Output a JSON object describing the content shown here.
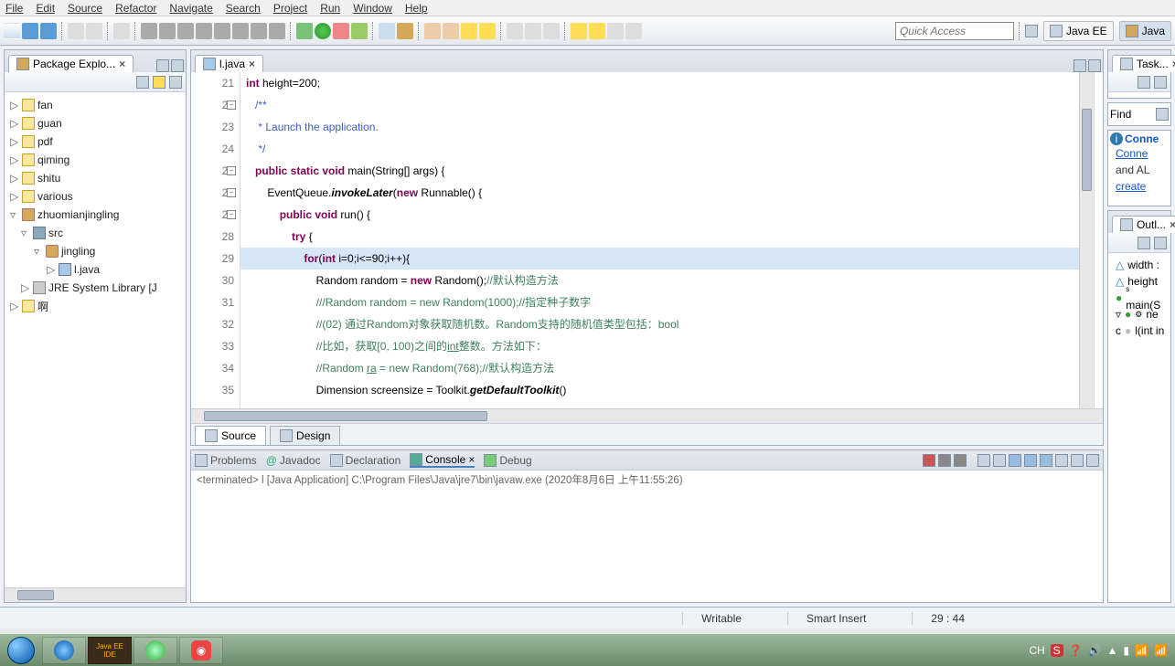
{
  "menu": [
    "File",
    "Edit",
    "Source",
    "Refactor",
    "Navigate",
    "Search",
    "Project",
    "Run",
    "Window",
    "Help"
  ],
  "quick_access_placeholder": "Quick Access",
  "perspectives": [
    {
      "label": "Java EE"
    },
    {
      "label": "Java"
    }
  ],
  "package_explorer": {
    "title": "Package Explo...",
    "items": [
      {
        "label": "fan",
        "depth": 0,
        "ico": "fold",
        "arrow": "▷"
      },
      {
        "label": "guan",
        "depth": 0,
        "ico": "fold",
        "arrow": "▷"
      },
      {
        "label": "pdf",
        "depth": 0,
        "ico": "fold",
        "arrow": "▷"
      },
      {
        "label": "qiming",
        "depth": 0,
        "ico": "fold",
        "arrow": "▷"
      },
      {
        "label": "shitu",
        "depth": 0,
        "ico": "fold",
        "arrow": "▷"
      },
      {
        "label": "various",
        "depth": 0,
        "ico": "fold",
        "arrow": "▷"
      },
      {
        "label": "zhuomianjingling",
        "depth": 0,
        "ico": "prj",
        "arrow": "▿"
      },
      {
        "label": "src",
        "depth": 1,
        "ico": "src",
        "arrow": "▿"
      },
      {
        "label": "jingling",
        "depth": 2,
        "ico": "pkg",
        "arrow": "▿"
      },
      {
        "label": "l.java",
        "depth": 3,
        "ico": "java",
        "arrow": "▷"
      },
      {
        "label": "JRE System Library [J",
        "depth": 1,
        "ico": "lib",
        "arrow": "▷"
      },
      {
        "label": "啊",
        "depth": 0,
        "ico": "fold",
        "arrow": "▷"
      }
    ]
  },
  "editor": {
    "tab_label": "l.java",
    "source_tab": "Source",
    "design_tab": "Design",
    "lines": [
      {
        "n": 21,
        "html": "<span class='kw'>int</span> height=200;"
      },
      {
        "n": 22,
        "fold": true,
        "html": "   <span class='jv'>/**</span>"
      },
      {
        "n": 23,
        "html": "    <span class='jv'>* Launch the application.</span>"
      },
      {
        "n": 24,
        "html": "    <span class='jv'>*/</span>"
      },
      {
        "n": 25,
        "fold": true,
        "html": "   <span class='kw'>public static void</span> main(String[] args) {"
      },
      {
        "n": 26,
        "fold": true,
        "html": "       EventQueue.<span class='tok-call'>invokeLater</span>(<span class='kw'>new</span> Runnable() {"
      },
      {
        "n": 27,
        "fold": true,
        "html": "           <span class='kw'>public void</span> run() {"
      },
      {
        "n": 28,
        "html": "               <span class='kw'>try</span> {"
      },
      {
        "n": 29,
        "cur": true,
        "html": "                   <span class='kw'>for</span>(<span class='kw'>int</span> i=0;i&lt;=90;i++){"
      },
      {
        "n": 30,
        "html": "                       Random random = <span class='kw'>new</span> Random();<span class='cm'>//默认构造方法</span>"
      },
      {
        "n": 31,
        "html": "                       <span class='cm'>///Random random = new Random(1000);//指定种子数字</span>"
      },
      {
        "n": 32,
        "html": "                       <span class='cm'>//(02) 通过Random对象获取随机数。Random支持的随机值类型包括：bool</span>"
      },
      {
        "n": 33,
        "html": "                       <span class='cm'>//比如，获取[0, 100)之间的<u>int</u>整数。方法如下：</span>"
      },
      {
        "n": 34,
        "html": "                       <span class='cm'>//Random <u>ra</u> = new Random(768);//默认构造方法</span>"
      },
      {
        "n": 35,
        "html": "                       Dimension screensize = Toolkit.<span class='tok-call'>getDefaultToolkit</span>()"
      }
    ]
  },
  "bottom_tabs": {
    "problems": "Problems",
    "javadoc": "Javadoc",
    "declaration": "Declaration",
    "console": "Console",
    "debug": "Debug"
  },
  "console_text": "<terminated> l [Java Application] C:\\Program Files\\Java\\jre7\\bin\\javaw.exe (2020年8月6日 上午11:55:26)",
  "status": {
    "writable": "Writable",
    "insert": "Smart Insert",
    "pos": "29 : 44"
  },
  "right": {
    "task_title": "Task...",
    "find": "Find",
    "conn_title": "Conne",
    "conn_link": "Conne",
    "conn_and": "and AL",
    "conn_create": "create",
    "outline_title": "Outl...",
    "outline": [
      {
        "sym": "△",
        "color": "#2a7ab0",
        "label": "width :"
      },
      {
        "sym": "△",
        "color": "#2a7ab0",
        "label": "height"
      },
      {
        "sym": "●",
        "color": "#3a9a3a",
        "label": "main(S",
        "suffix": "s"
      },
      {
        "sym": "●",
        "color": "#3a9a3a",
        "label": "ne",
        "prefix": "▿",
        "gear": true
      },
      {
        "sym": "●",
        "color": "#bbb",
        "label": "l(int in",
        "prefix": "c"
      }
    ]
  },
  "tray": {
    "lang": "CH",
    "icons": "S ❓ 🔊 ▲ 📶 📶"
  }
}
